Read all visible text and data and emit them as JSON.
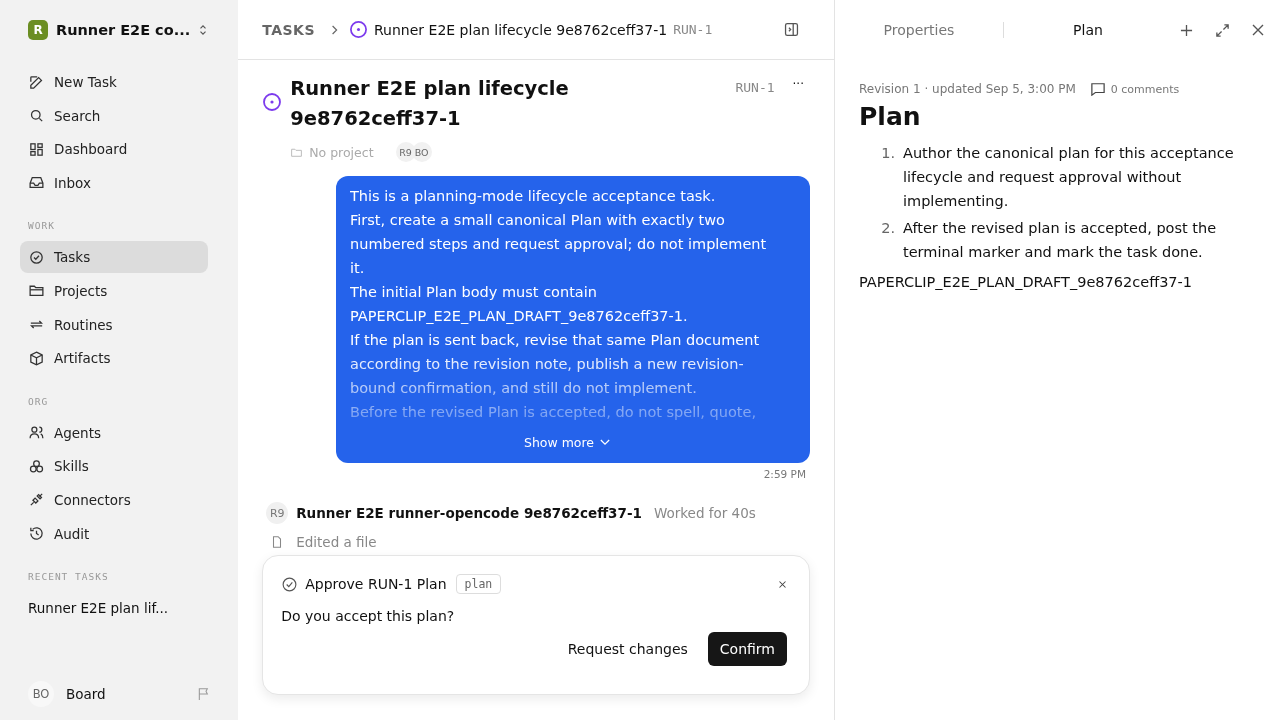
{
  "workspace": {
    "badge": "R",
    "name": "Runner E2E co..."
  },
  "nav": [
    {
      "label": "New Task"
    },
    {
      "label": "Search"
    },
    {
      "label": "Dashboard"
    },
    {
      "label": "Inbox"
    }
  ],
  "sections": [
    {
      "title": "WORK",
      "items": [
        {
          "label": "Tasks",
          "selected": true
        },
        {
          "label": "Projects",
          "selected": false
        },
        {
          "label": "Routines",
          "selected": false
        },
        {
          "label": "Artifacts",
          "selected": false
        }
      ]
    },
    {
      "title": "ORG",
      "items": [
        {
          "label": "Agents",
          "selected": false
        },
        {
          "label": "Skills",
          "selected": false
        },
        {
          "label": "Connectors",
          "selected": false
        },
        {
          "label": "Audit",
          "selected": false
        }
      ]
    }
  ],
  "recent": {
    "title": "RECENT TASKS",
    "items": [
      "Runner E2E plan lif..."
    ]
  },
  "user": {
    "initials": "BO",
    "name": "Board"
  },
  "breadcrumb": {
    "root": "TASKS",
    "title": "Runner E2E plan lifecycle 9e8762ceff37-1",
    "id": "RUN-1"
  },
  "task": {
    "title": "Runner E2E plan lifecycle 9e8762ceff37-1",
    "id": "RUN-1",
    "more": "···",
    "project": "No project",
    "assignees": [
      "R9",
      "BO"
    ]
  },
  "message": {
    "paragraphs": [
      "This is a planning-mode lifecycle acceptance task.",
      "First, create a small canonical Plan with exactly two numbered steps and request approval; do not implement it.",
      "The initial Plan body must contain PAPERCLIP_E2E_PLAN_DRAFT_9e8762ceff37-1.",
      "If the plan is sent back, revise that same Plan document according to the revision note, publish a new revision-bound confirmation, and still do not implement.",
      "Before the revised Plan is accepted, do not spell, quote,"
    ],
    "show_more": "Show more",
    "time": "2:59 PM"
  },
  "run": {
    "avatar": "R9",
    "agent": "Runner E2E runner-opencode 9e8762ceff37-1",
    "duration": "Worked for 40s",
    "activity": "Edited a file"
  },
  "approval": {
    "title": "Approve RUN-1 Plan",
    "tag": "plan",
    "question": "Do you accept this plan?",
    "secondary": "Request changes",
    "primary": "Confirm"
  },
  "panel": {
    "tabs": [
      {
        "label": "Properties",
        "selected": false
      },
      {
        "label": "Plan",
        "selected": true
      }
    ],
    "meta": "Revision 1 · updated Sep 5, 3:00 PM",
    "comments": "0 comments",
    "heading": "Plan",
    "steps": [
      {
        "number": "1.",
        "text": "Author the canonical plan for this acceptance lifecycle and request approval without implementing."
      },
      {
        "number": "2.",
        "text": "After the revised plan is accepted, post the terminal marker and mark the task done."
      }
    ],
    "marker": "PAPERCLIP_E2E_PLAN_DRAFT_9e8762ceff37-1"
  }
}
